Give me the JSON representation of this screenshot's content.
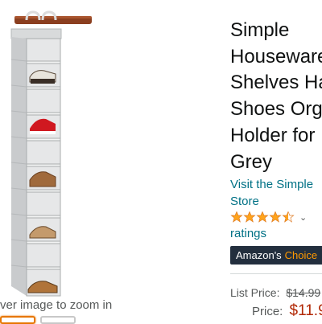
{
  "gallery": {
    "zoom_hint": "ver image to zoom in",
    "product_image": "hanging-shoe-organizer-photo",
    "thumbnail_count": 2
  },
  "product": {
    "title_lines": [
      "Simple",
      "Houseware",
      "Shelves Ha",
      "Shoes Org",
      "Holder for",
      "Grey"
    ],
    "store_link_lines": [
      "Visit the Simple",
      "Store"
    ],
    "rating_stars": 4.5,
    "ratings_label": "ratings",
    "badge": {
      "prefix": "Amazon's",
      "choice": "Choice"
    },
    "list_price_label": "List Price:",
    "list_price_value": "$14.99",
    "price_label": "Price:",
    "price_value": "$11.9"
  },
  "colors": {
    "link": "#007185",
    "price": "#b12704",
    "star": "#ffa41c",
    "badge_bg": "#232f3e",
    "badge_accent": "#ff9900"
  }
}
